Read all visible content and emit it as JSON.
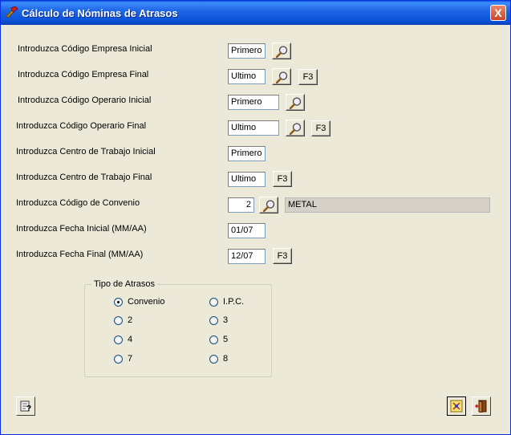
{
  "window": {
    "title": "Cálculo de Nóminas de Atrasos",
    "close_label": "X"
  },
  "form": {
    "rows": [
      {
        "label": "Introduzca Código Empresa Inicial",
        "value": "Primero"
      },
      {
        "label": "Introduzca Código Empresa Final",
        "value": "Ultimo",
        "f3": "F3"
      },
      {
        "label": "Introduzca Código Operario Inicial",
        "value": "Primero"
      },
      {
        "label": "Introduzca Código Operario Final",
        "value": "Ultimo",
        "f3": "F3"
      },
      {
        "label": "Introduzca Centro de Trabajo  Inicial",
        "value": "Primero"
      },
      {
        "label": "Introduzca Centro de Trabajo  Final",
        "value": "Ultimo",
        "f3": "F3"
      },
      {
        "label": "Introduzca Código de Convenio",
        "value": "2",
        "desc": "METAL"
      },
      {
        "label": "Introduzca Fecha Inicial (MM/AA)",
        "value": "01/07"
      },
      {
        "label": "Introduzca Fecha Final (MM/AA)",
        "value": "12/07",
        "f3": "F3"
      }
    ]
  },
  "tipo_atrasos": {
    "legend": "Tipo de Atrasos",
    "options": [
      "Convenio",
      "I.P.C.",
      "2",
      "3",
      "4",
      "5",
      "7",
      "8"
    ],
    "selected": "Convenio"
  },
  "icons": {
    "app": "hammer-icon",
    "search": "magnifier-icon",
    "help": "help-icon",
    "execute": "execute-icon",
    "exit": "exit-door-icon"
  }
}
